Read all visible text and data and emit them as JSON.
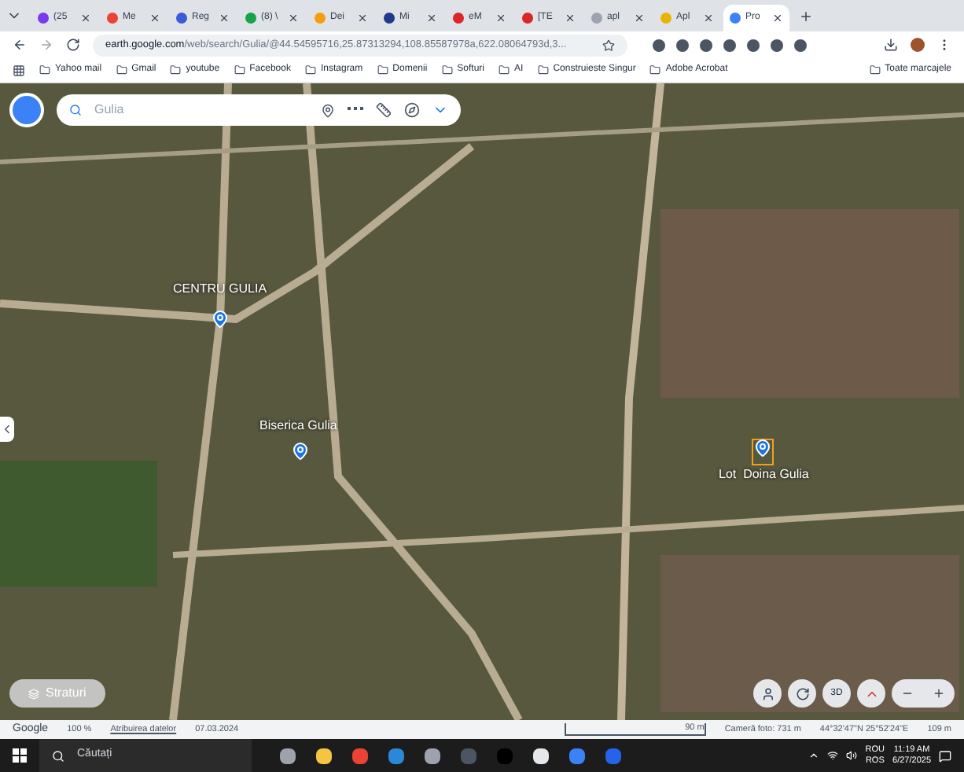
{
  "tabs": [
    {
      "label": "(25",
      "selected": false
    },
    {
      "label": "Me",
      "selected": false
    },
    {
      "label": "Reg",
      "selected": false
    },
    {
      "label": "(8) \\",
      "selected": false
    },
    {
      "label": "Dei",
      "selected": false
    },
    {
      "label": "Mi",
      "selected": false
    },
    {
      "label": "eM",
      "selected": false
    },
    {
      "label": "[TE",
      "selected": false
    },
    {
      "label": "apl",
      "selected": false
    },
    {
      "label": "Apl",
      "selected": false
    },
    {
      "label": "Pro",
      "selected": true
    }
  ],
  "address_bar": {
    "url_host": "earth.google.com",
    "url_path": "/web/search/Gulia/@44.54595716,25.87313294,108.85587978a,622.08064793d,3..."
  },
  "bookmarks": [
    "Yahoo mail",
    "Gmail",
    "youtube",
    "Facebook",
    "Instagram",
    "Domenii",
    "Softuri",
    "AI",
    "Construieste Singur",
    "Adobe Acrobat"
  ],
  "bookmarks_right": "Toate marcajele",
  "search": {
    "placeholder": "Gulia"
  },
  "map": {
    "places": [
      {
        "label": "CENTRU GULIA",
        "kind": "pin"
      },
      {
        "label": "Biserica Gulia",
        "kind": "pin"
      },
      {
        "label": "Lot  Doina Gulia",
        "kind": "lot"
      }
    ],
    "layers_button": "Straturi",
    "button_3d": "3D"
  },
  "status_bar": {
    "logo": "Google",
    "zoom": "100 %",
    "attribution": "Atribuirea datelor",
    "date": "07.03.2024",
    "scale": "90 m",
    "camera": "Cameră foto: 731 m",
    "coords": "44°32'47\"N 25°52'24\"E",
    "elevation": "109 m"
  },
  "taskbar": {
    "search_placeholder": "Căutați",
    "lang_1": "ROU",
    "lang_2": "ROS",
    "time": "11:19 AM",
    "date": "6/27/2025"
  }
}
